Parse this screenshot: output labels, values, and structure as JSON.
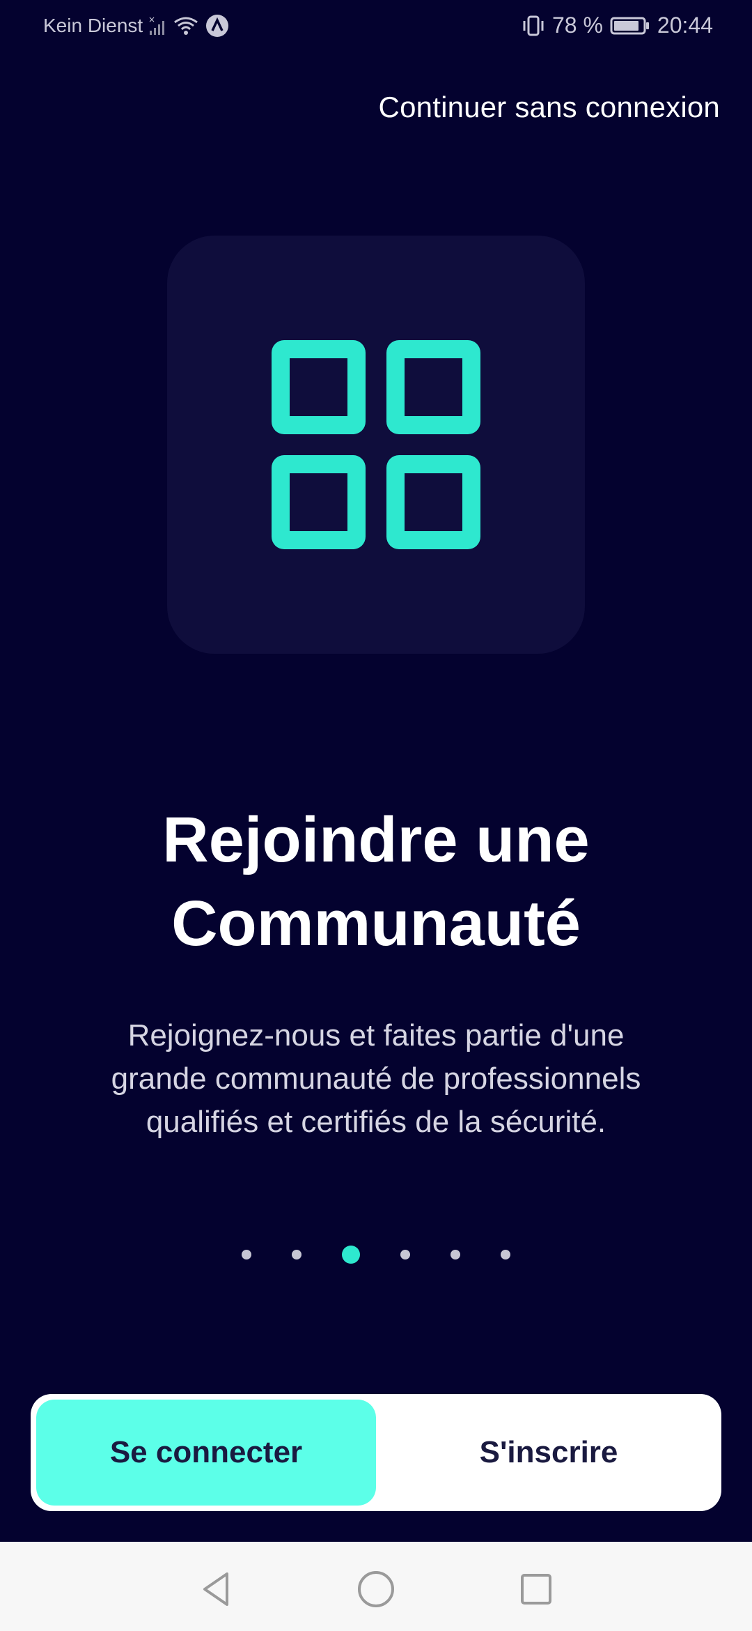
{
  "status_bar": {
    "carrier": "Kein Dienst",
    "battery_percent": "78 %",
    "time": "20:44",
    "icons": [
      "no-signal-icon",
      "wifi-icon",
      "data-saver-icon",
      "vibrate-icon",
      "battery-icon"
    ]
  },
  "header": {
    "skip_label": "Continuer sans connexion"
  },
  "illustration": {
    "icon": "grid-icon",
    "accent_color": "#2ee8cf"
  },
  "content": {
    "title_line1": "Rejoindre une",
    "title_line2": "Communauté",
    "description_line1": "Rejoignez-nous et faites partie d'une",
    "description_line2": "grande communauté de professionnels",
    "description_line3": "qualifiés et certifiés de la sécurité."
  },
  "pager": {
    "total": 6,
    "active_index": 2
  },
  "auth": {
    "login_label": "Se connecter",
    "signup_label": "S'inscrire"
  },
  "colors": {
    "background": "#04022f",
    "accent": "#5cffe8",
    "dot_active": "#2ee8cf"
  },
  "nav_bar": {
    "icons": [
      "back-icon",
      "home-icon",
      "recent-apps-icon"
    ]
  }
}
